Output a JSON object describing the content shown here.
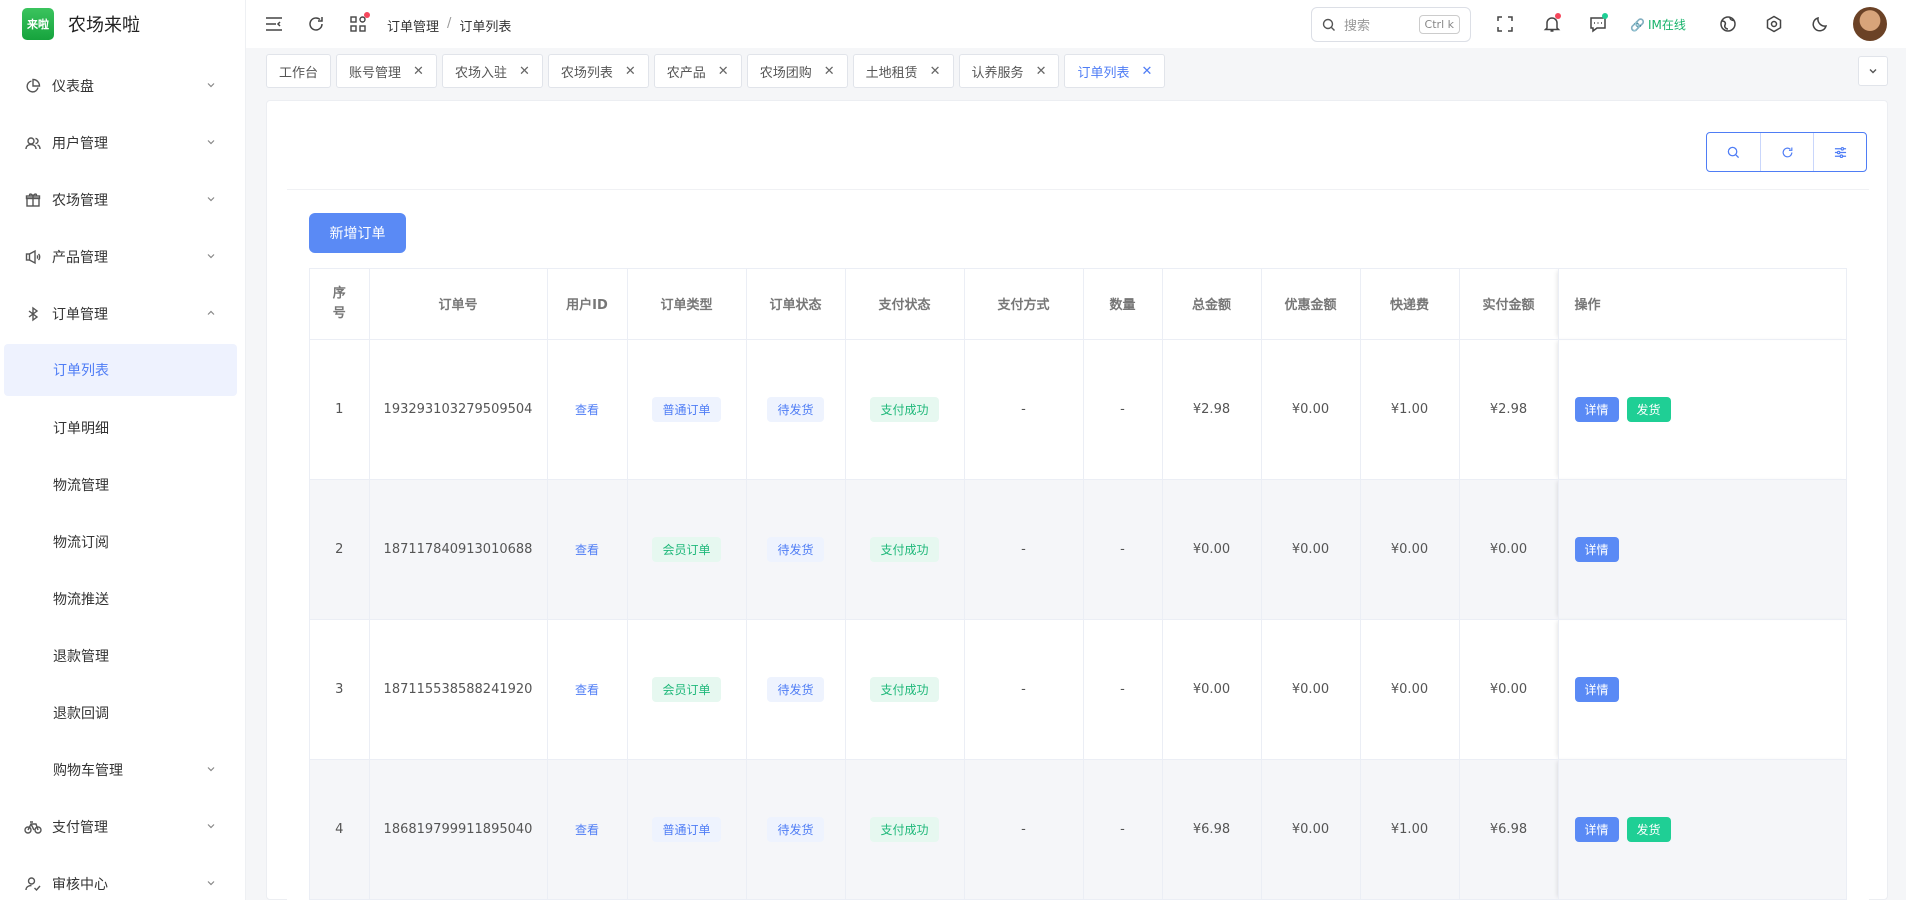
{
  "app": {
    "logo_text": "来啦",
    "title": "农场来啦"
  },
  "sidebar": {
    "items": [
      {
        "label": "仪表盘",
        "icon": "pie-chart-icon"
      },
      {
        "label": "用户管理",
        "icon": "users-icon"
      },
      {
        "label": "农场管理",
        "icon": "gift-icon"
      },
      {
        "label": "产品管理",
        "icon": "speaker-icon"
      },
      {
        "label": "订单管理",
        "icon": "bluetooth-icon",
        "expanded": true
      },
      {
        "label": "支付管理",
        "icon": "bicycle-icon"
      },
      {
        "label": "审核中心",
        "icon": "user-check-icon"
      }
    ],
    "order_sub": [
      "订单列表",
      "订单明细",
      "物流管理",
      "物流订阅",
      "物流推送",
      "退款管理",
      "退款回调",
      "购物车管理"
    ]
  },
  "header": {
    "breadcrumb": [
      "订单管理",
      "订单列表"
    ],
    "breadcrumb_sep": "/",
    "search_placeholder": "搜索",
    "search_shortcut": "Ctrl k",
    "im_status": "IM在线"
  },
  "tabs": [
    {
      "label": "工作台",
      "closable": false
    },
    {
      "label": "账号管理",
      "closable": true
    },
    {
      "label": "农场入驻",
      "closable": true
    },
    {
      "label": "农场列表",
      "closable": true
    },
    {
      "label": "农产品",
      "closable": true
    },
    {
      "label": "农场团购",
      "closable": true
    },
    {
      "label": "土地租赁",
      "closable": true
    },
    {
      "label": "认养服务",
      "closable": true
    },
    {
      "label": "订单列表",
      "closable": true,
      "active": true
    }
  ],
  "toolbar": {
    "add_label": "新增订单"
  },
  "table": {
    "columns": [
      "序号",
      "订单号",
      "用户ID",
      "订单类型",
      "订单状态",
      "支付状态",
      "支付方式",
      "数量",
      "总金额",
      "优惠金额",
      "快递费",
      "实付金额",
      "操作"
    ],
    "rows": [
      {
        "index": "1",
        "order_no": "193293103279509504",
        "user_link": "查看",
        "type": "普通订单",
        "status": "待发货",
        "pay_status": "支付成功",
        "pay_method": "-",
        "qty": "-",
        "total": "¥2.98",
        "discount": "¥0.00",
        "shipping": "¥1.00",
        "paid": "¥2.98",
        "actions": [
          "详情",
          "发货"
        ]
      },
      {
        "index": "2",
        "order_no": "187117840913010688",
        "user_link": "查看",
        "type": "会员订单",
        "status": "待发货",
        "pay_status": "支付成功",
        "pay_method": "-",
        "qty": "-",
        "total": "¥0.00",
        "discount": "¥0.00",
        "shipping": "¥0.00",
        "paid": "¥0.00",
        "actions": [
          "详情"
        ]
      },
      {
        "index": "3",
        "order_no": "187115538588241920",
        "user_link": "查看",
        "type": "会员订单",
        "status": "待发货",
        "pay_status": "支付成功",
        "pay_method": "-",
        "qty": "-",
        "total": "¥0.00",
        "discount": "¥0.00",
        "shipping": "¥0.00",
        "paid": "¥0.00",
        "actions": [
          "详情"
        ]
      },
      {
        "index": "4",
        "order_no": "186819799911895040",
        "user_link": "查看",
        "type": "普通订单",
        "status": "待发货",
        "pay_status": "支付成功",
        "pay_method": "-",
        "qty": "-",
        "total": "¥6.98",
        "discount": "¥0.00",
        "shipping": "¥1.00",
        "paid": "¥6.98",
        "actions": [
          "详情",
          "发货"
        ]
      }
    ]
  },
  "colors": {
    "primary": "#4f7df5",
    "success": "#1fcf95",
    "brand": "#16a33d"
  }
}
